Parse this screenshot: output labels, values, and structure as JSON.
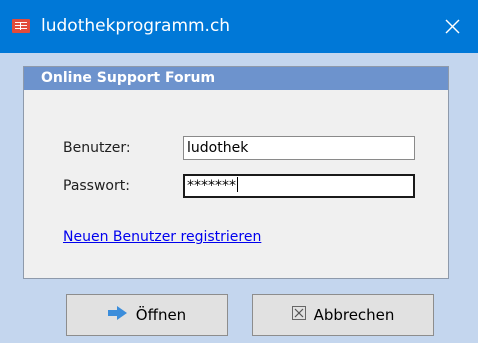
{
  "window": {
    "title": "ludothekprogramm.ch"
  },
  "panel": {
    "heading": "Online Support Forum"
  },
  "form": {
    "username_label": "Benutzer:",
    "username_value": "ludothek",
    "password_label": "Passwort:",
    "password_value": "*******",
    "register_link": "Neuen Benutzer registrieren"
  },
  "buttons": {
    "open_label": "Öffnen",
    "cancel_label": "Abbrechen"
  },
  "colors": {
    "titlebar": "#0078d7",
    "panel_header": "#6d93cd",
    "window_background": "#c4d6ee",
    "link": "#0000ee"
  },
  "icons": {
    "app": "app-form-icon",
    "close": "close-icon",
    "open": "arrow-right-icon",
    "cancel": "cancel-x-icon"
  }
}
